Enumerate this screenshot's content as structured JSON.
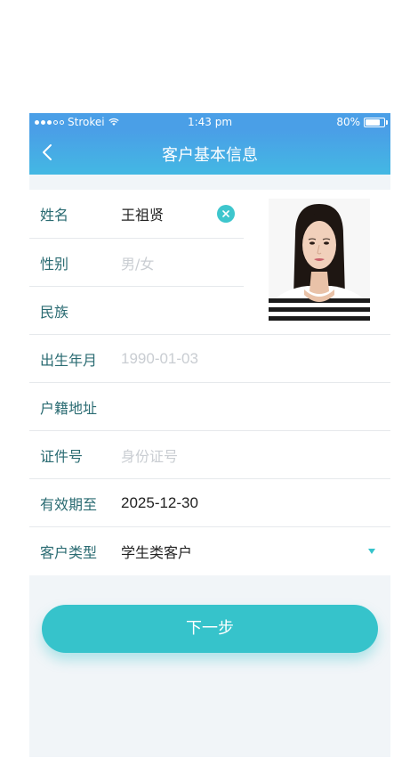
{
  "status_bar": {
    "carrier": "Strokei",
    "time": "1:43 pm",
    "battery": "80%",
    "battery_level": 0.8
  },
  "nav": {
    "title": "客户基本信息",
    "back_icon": "chevron-left-icon"
  },
  "form": {
    "name": {
      "label": "姓名",
      "value": "王祖贤"
    },
    "gender": {
      "label": "性别",
      "placeholder": "男/女"
    },
    "ethnicity": {
      "label": "民族",
      "value": ""
    },
    "birth": {
      "label": "出生年月",
      "placeholder": "1990-01-03"
    },
    "address": {
      "label": "户籍地址",
      "value": ""
    },
    "id_number": {
      "label": "证件号",
      "placeholder": "身份证号"
    },
    "valid_until": {
      "label": "有效期至",
      "value": "2025-12-30"
    },
    "customer_type": {
      "label": "客户类型",
      "value": "学生类客户"
    }
  },
  "next_button": {
    "label": "下一步"
  },
  "colors": {
    "accent": "#36c3cb",
    "nav_top": "#4a9fe7",
    "nav_bottom": "#43b8e3",
    "label": "#2a6b72",
    "placeholder": "#c9cdd2"
  }
}
